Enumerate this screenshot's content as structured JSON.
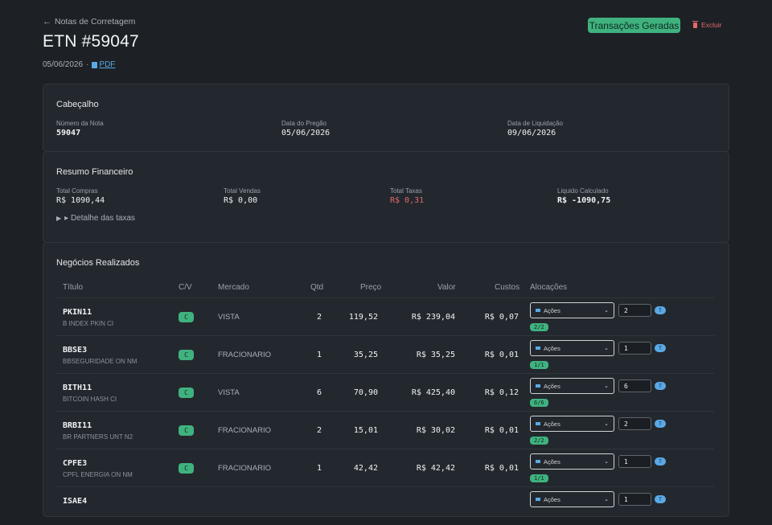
{
  "header": {
    "back_label": "Notas de Corretagem",
    "title": "ETN #59047",
    "date": "05/06/2026",
    "separator": "·",
    "pdf_label": "PDF",
    "status": "Transações Geradas",
    "delete_label": "Excluir"
  },
  "cabecalho": {
    "title": "Cabeçalho",
    "fields": [
      {
        "label": "Número da Nota",
        "value": "59047"
      },
      {
        "label": "Data do Pregão",
        "value": "05/06/2026"
      },
      {
        "label": "Data de Liquidação",
        "value": "09/06/2026"
      }
    ]
  },
  "resumo": {
    "title": "Resumo Financeiro",
    "fields": [
      {
        "label": "Total Compras",
        "value": "R$ 1090,44"
      },
      {
        "label": "Total Vendas",
        "value": "R$ 0,00"
      },
      {
        "label": "Total Taxas",
        "value": "R$ 0,31"
      },
      {
        "label": "Liquido Calculado",
        "value": "R$ -1090,75"
      }
    ],
    "details_label": "▸ Detalhe das taxas"
  },
  "negocios": {
    "title": "Negócios Realizados",
    "columns": [
      "Título",
      "C/V",
      "Mercado",
      "Qtd",
      "Preço",
      "Valor",
      "Custos",
      "Alocações"
    ],
    "rows": [
      {
        "ticker": "PKIN11",
        "desc": "B INDEX PKIN CI",
        "cv": "C",
        "mercado": "VISTA",
        "qtd": "2",
        "preco": "119,52",
        "valor": "R$ 239,04",
        "custos": "R$ 0,07",
        "alloc_type": "Ações",
        "alloc_qty": "2",
        "tag": "T",
        "alloc_status": "2/2"
      },
      {
        "ticker": "BBSE3",
        "desc": "BBSEGURIDADE ON NM",
        "cv": "C",
        "mercado": "FRACIONARIO",
        "qtd": "1",
        "preco": "35,25",
        "valor": "R$ 35,25",
        "custos": "R$ 0,01",
        "alloc_type": "Ações",
        "alloc_qty": "1",
        "tag": "T",
        "alloc_status": "1/1"
      },
      {
        "ticker": "BITH11",
        "desc": "BITCOIN HASH CI",
        "cv": "C",
        "mercado": "VISTA",
        "qtd": "6",
        "preco": "70,90",
        "valor": "R$ 425,40",
        "custos": "R$ 0,12",
        "alloc_type": "Ações",
        "alloc_qty": "6",
        "tag": "T",
        "alloc_status": "6/6"
      },
      {
        "ticker": "BRBI11",
        "desc": "BR PARTNERS UNT N2",
        "cv": "C",
        "mercado": "FRACIONARIO",
        "qtd": "2",
        "preco": "15,01",
        "valor": "R$ 30,02",
        "custos": "R$ 0,01",
        "alloc_type": "Ações",
        "alloc_qty": "2",
        "tag": "T",
        "alloc_status": "2/2"
      },
      {
        "ticker": "CPFE3",
        "desc": "CPFL ENERGIA ON NM",
        "cv": "C",
        "mercado": "FRACIONARIO",
        "qtd": "1",
        "preco": "42,42",
        "valor": "R$ 42,42",
        "custos": "R$ 0,01",
        "alloc_type": "Ações",
        "alloc_qty": "1",
        "tag": "T",
        "alloc_status": "1/1"
      },
      {
        "ticker": "ISAE4",
        "desc": "",
        "cv": "",
        "mercado": "",
        "qtd": "",
        "preco": "",
        "valor": "",
        "custos": "",
        "alloc_type": "Ações",
        "alloc_qty": "1",
        "tag": "T",
        "alloc_status": ""
      }
    ]
  },
  "colors": {
    "accent_green": "#3fb27f",
    "link_blue": "#5aa9e6",
    "danger_red": "#e26a6a",
    "bg": "#1d2126",
    "card": "#23282e"
  }
}
